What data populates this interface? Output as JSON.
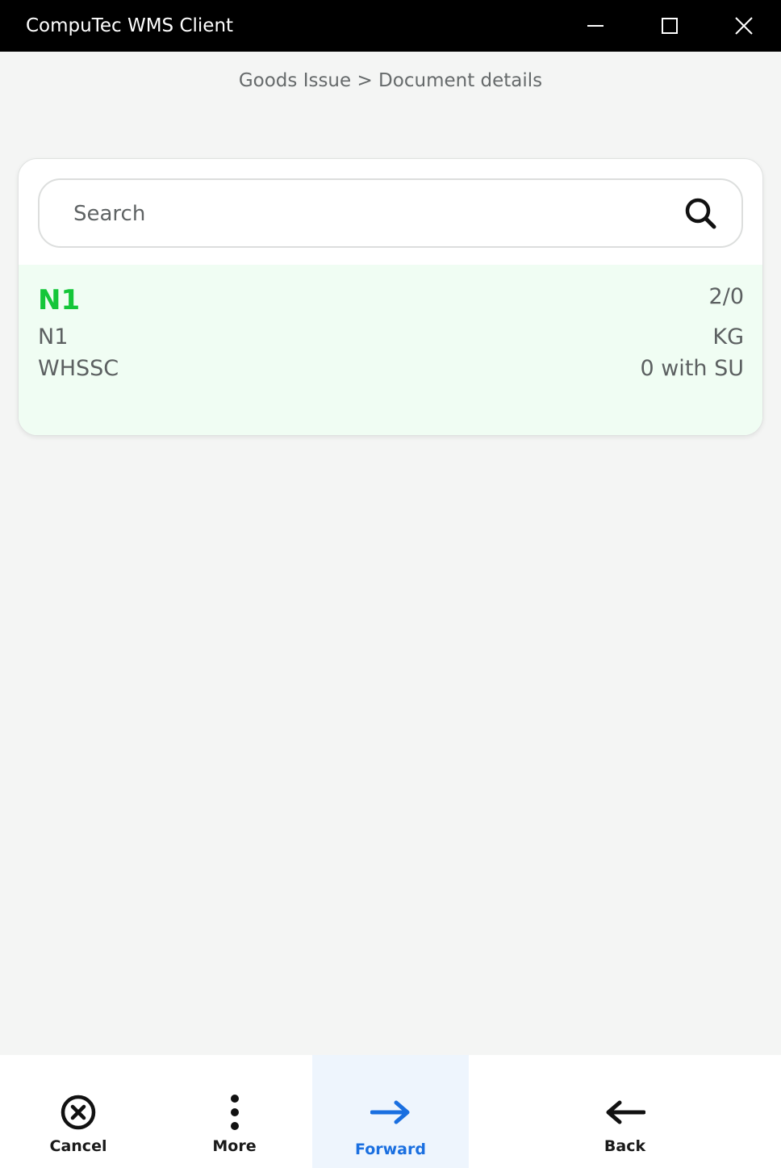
{
  "window": {
    "title": "CompuTec WMS Client"
  },
  "breadcrumb": "Goods Issue > Document details",
  "search": {
    "placeholder": "Search",
    "value": ""
  },
  "items": [
    {
      "code": "N1",
      "description": "N1",
      "warehouse": "WHSSC",
      "quantity": "2/0",
      "uom": "KG",
      "storage_units": "0 with SU"
    }
  ],
  "bottom_bar": {
    "cancel_label": "Cancel",
    "more_label": "More",
    "forward_label": "Forward",
    "back_label": "Back"
  },
  "colors": {
    "titlebar": "#000000",
    "item_code": "#14c639",
    "item_row_bg": "#f0fdf3",
    "forward_accent": "#1a6fe0",
    "forward_bg": "#eef5fd",
    "page_bg": "#f4f5f4"
  },
  "icons": {
    "minimize": "minimize-icon",
    "maximize": "maximize-icon",
    "close": "close-icon",
    "search": "search-icon",
    "cancel": "cancel-circle-icon",
    "more": "more-vertical-icon",
    "forward": "arrow-right-icon",
    "back": "arrow-left-icon"
  }
}
